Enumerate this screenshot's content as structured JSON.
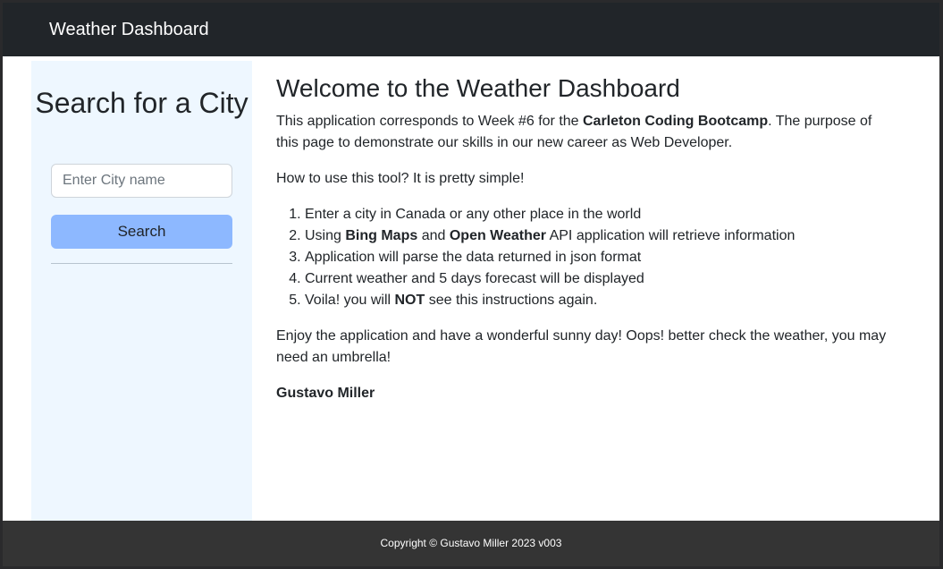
{
  "navbar": {
    "brand": "Weather Dashboard"
  },
  "sidebar": {
    "title": "Search for a City",
    "input_placeholder": "Enter City name",
    "search_label": "Search"
  },
  "main": {
    "title": "Welcome to the Weather Dashboard",
    "intro": {
      "pre": "This application corresponds to Week #6 for the ",
      "bootcamp": "Carleton Coding Bootcamp",
      "post": ". The purpose of this page to demonstrate our skills in our new career as Web Developer."
    },
    "howto": "How to use this tool? It is pretty simple!",
    "steps": {
      "step1": "Enter a city in Canada or any other place in the world",
      "step2": {
        "pre": "Using ",
        "bing": "Bing Maps",
        "and": " and ",
        "ow": "Open Weather",
        "post": " API application will retrieve information"
      },
      "step3": "Application will parse the data returned in json format",
      "step4": "Current weather and 5 days forecast will be displayed",
      "step5": {
        "pre": "Voila! you will ",
        "not": "NOT",
        "post": " see this instructions again."
      }
    },
    "closing": "Enjoy the application and have a wonderful sunny day! Oops! better check the weather, you may need an umbrella!",
    "author": "Gustavo Miller"
  },
  "footer": {
    "text": "Copyright © Gustavo Miller 2023 v003"
  },
  "colors": {
    "navbar_bg": "#212529",
    "sidebar_bg": "#eef7ff",
    "button_bg": "#8db8ff",
    "footer_bg": "#343434"
  }
}
